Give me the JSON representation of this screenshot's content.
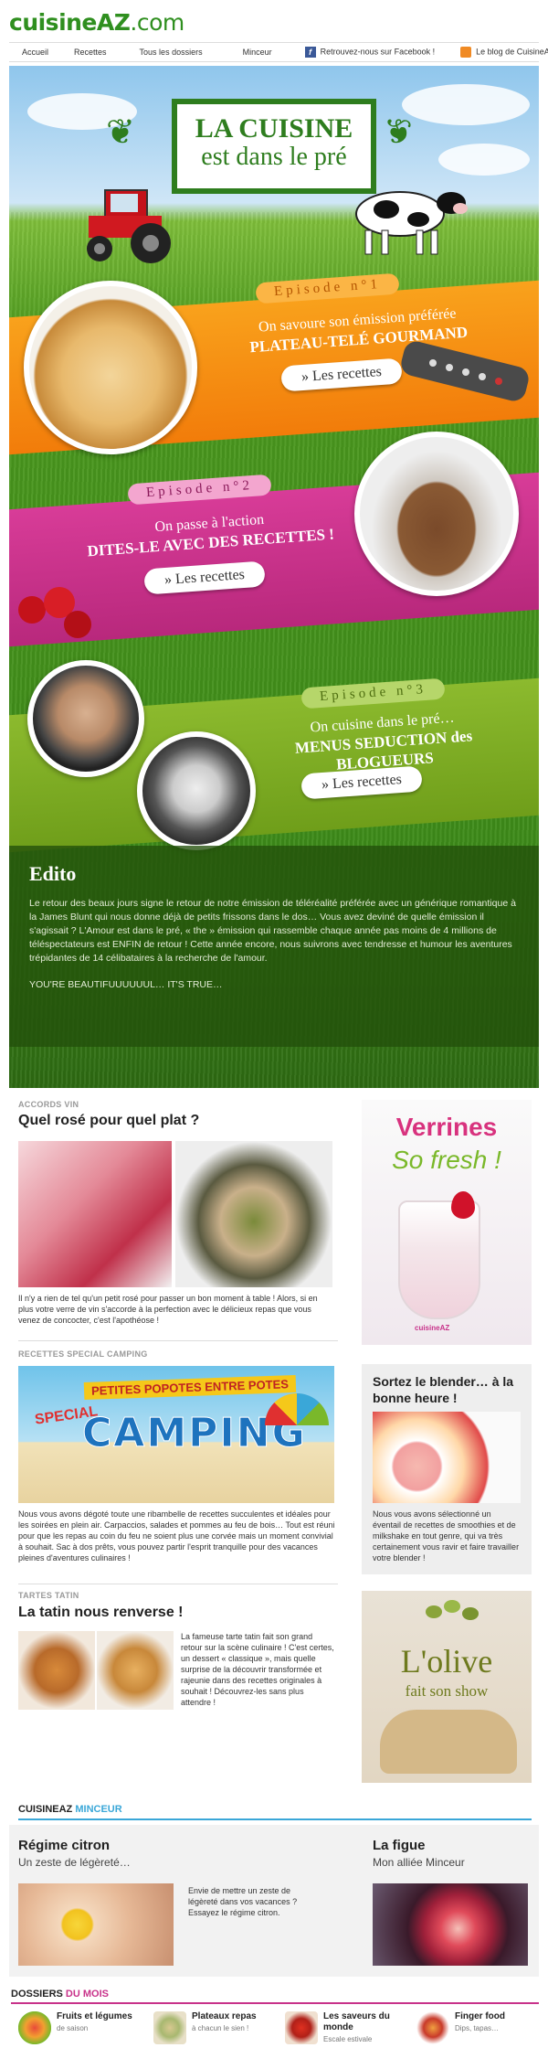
{
  "logo": {
    "brand": "cuisineAZ",
    "tld": ".com"
  },
  "nav": {
    "items": [
      "Accueil",
      "Recettes",
      "Tous les dossiers",
      "Minceur"
    ],
    "facebook": "Retrouvez-nous sur Facebook !",
    "blog": "Le blog de CuisineAZ !"
  },
  "hero": {
    "title_line1": "LA CUISINE",
    "title_line2": "est dans le pré",
    "episodes": [
      {
        "label": "Episode n°1",
        "line1": "On savoure son émission préférée",
        "line2": "PLATEAU-TELÉ GOURMAND",
        "button": "» Les recettes"
      },
      {
        "label": "Episode n°2",
        "line1": "On passe à l'action",
        "line2": "DITES-LE AVEC DES RECETTES !",
        "button": "» Les recettes"
      },
      {
        "label": "Episode n°3",
        "line1": "On cuisine dans le pré…",
        "line2": "MENUS SEDUCTION des BLOGUEURS",
        "button": "» Les recettes"
      }
    ]
  },
  "edito": {
    "title": "Edito",
    "text": "Le retour des beaux jours signe le retour de notre émission de téléréalité préférée avec un générique romantique à la James Blunt qui nous donne déjà de petits frissons dans le dos… Vous avez deviné de quelle émission il s'agissait ? L'Amour est dans le pré, « the » émission qui rassemble chaque année pas moins de 4 millions de téléspectateurs est ENFIN de retour ! Cette année encore, nous suivrons avec tendresse et humour les aventures trépidantes de 14 célibataires à la recherche de l'amour.",
    "tagline": "YOU'RE BEAUTIFUUUUUUL… IT'S TRUE…"
  },
  "articles": [
    {
      "label": "ACCORDS VIN",
      "title": "Quel rosé pour quel plat ?",
      "text": "Il n'y a rien de tel qu'un petit rosé pour passer un bon moment à table ! Alors, si en plus votre verre de vin s'accorde à la perfection avec le délicieux repas que vous venez de concocter, c'est l'apothéose !"
    },
    {
      "label": "RECETTES SPECIAL CAMPING",
      "banner_top": "PETITES POPOTES ENTRE POTES",
      "banner_special": "SPECIAL",
      "banner_main": "CAMPING",
      "text": "Nous vous avons dégoté toute une ribambelle de recettes succulentes et idéales pour les soirées en plein air. Carpaccios, salades et pommes au feu de bois… Tout est réuni pour que les repas au coin du feu ne soient plus une corvée mais un moment convivial à souhait. Sac à dos prêts, vous pouvez partir l'esprit tranquille pour des vacances pleines d'aventures culinaires !"
    },
    {
      "label": "TARTES TATIN",
      "title": "La tatin nous renverse !",
      "text": "La fameuse tarte tatin fait son grand retour sur la scène culinaire ! C'est certes, un dessert « classique », mais quelle surprise de la découvrir transformée et rajeunie dans des recettes originales à souhait ! Découvrez-les sans plus attendre !"
    }
  ],
  "side": {
    "verrines_line1": "Verrines",
    "verrines_line2": "So fresh !",
    "verrines_badge": "cuisineAZ",
    "blender_title": "Sortez le blender… à la bonne heure !",
    "blender_text": "Nous vous avons sélectionné un éventail de recettes de smoothies et de milkshake en tout genre, qui va très certainement vous ravir et faire travailler votre blender !",
    "olive_line1": "L'olive",
    "olive_line2": "fait son show"
  },
  "minceur": {
    "header_a": "CUISINEAZ",
    "header_b": "MINCEUR",
    "left_title": "Régime citron",
    "left_sub": "Un zeste de légèreté…",
    "left_text": "Envie de mettre un zeste de légèreté dans vos vacances ? Essayez le régime citron.",
    "right_title": "La figue",
    "right_sub": "Mon alliée Minceur"
  },
  "dossiers": {
    "header_a": "DOSSIERS",
    "header_b": "DU MOIS",
    "items": [
      {
        "title": "Fruits et légumes",
        "sub": "de saison"
      },
      {
        "title": "Plateaux repas",
        "sub": "à chacun le sien !"
      },
      {
        "title": "Les saveurs du monde",
        "sub": "Escale estivale"
      },
      {
        "title": "Finger food",
        "sub": "Dips, tapas…"
      }
    ]
  },
  "colors": {
    "brand_green": "#2e7d1e",
    "orange": "#f27c0a",
    "pink": "#c8328a",
    "lime": "#8cba2e",
    "minceur_blue": "#3aa7d8",
    "dossier_pink": "#c8328a"
  }
}
